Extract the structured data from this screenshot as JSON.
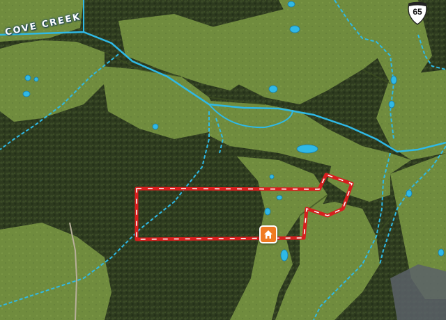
{
  "map": {
    "labels": {
      "creek_name": "COVE CREEK",
      "highway_number": "65"
    },
    "colors": {
      "water": "#2fb9e6",
      "boundary": "#d81e1e",
      "boundary_dash": "#ffffff",
      "marker": "#f07a22",
      "forest": "#2c3a1e",
      "pasture": "#6f8b3c"
    },
    "icons": {
      "highway_shield": "us-highway-shield-icon",
      "property_marker": "home-icon"
    }
  }
}
